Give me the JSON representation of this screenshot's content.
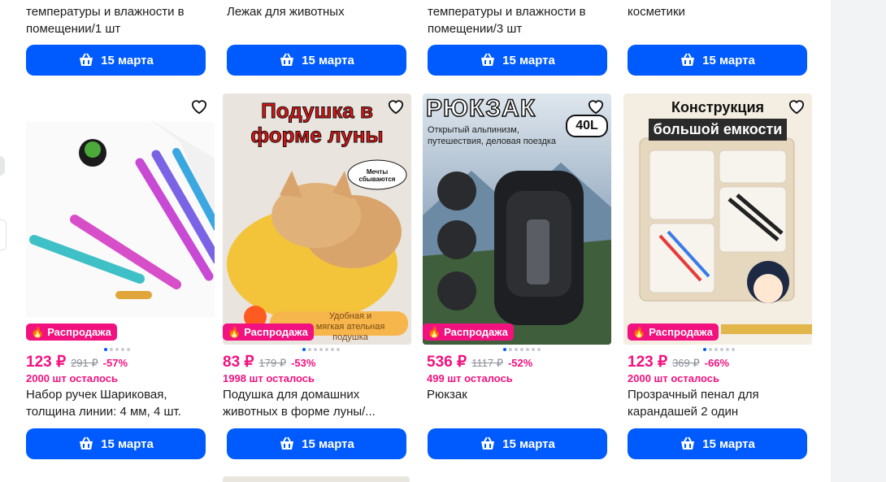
{
  "colors": {
    "accent": "#005bff",
    "sale": "#f2127f"
  },
  "top_row": [
    {
      "title": "температуры и влажности в помещении/1 шт",
      "button": "15 марта"
    },
    {
      "title": "Лежак для животных",
      "button": "15 марта"
    },
    {
      "title": "температуры и влажности в помещении/3 шт",
      "button": "15 марта"
    },
    {
      "title": "косметики",
      "button": "15 марта"
    }
  ],
  "products": [
    {
      "badge": "Распродажа",
      "price": "123 ₽",
      "old_price": "291 ₽",
      "discount": "-57%",
      "stock": "2000 шт осталось",
      "name": "Набор ручек Шариковая, толщина линии: 4 мм, 4 шт.",
      "button": "15 марта",
      "image_text": []
    },
    {
      "badge": "Распродажа",
      "price": "83 ₽",
      "old_price": "179 ₽",
      "discount": "-53%",
      "stock": "1998 шт осталось",
      "name": "Подушка для домашних животных в форме луны/...",
      "button": "15 марта",
      "image_text": [
        "Подушка в",
        "форме луны",
        "Мечты сбываются",
        "Удобная и",
        "мягкая ательная подушка"
      ]
    },
    {
      "badge": "Распродажа",
      "price": "536 ₽",
      "old_price": "1117 ₽",
      "discount": "-52%",
      "stock": "499 шт осталось",
      "name": "Рюкзак",
      "button": "15 марта",
      "image_text": [
        "РЮКЗАК",
        "40L",
        "Открытый альпинизм,",
        "путешествия, деловая поездка"
      ]
    },
    {
      "badge": "Распродажа",
      "price": "123 ₽",
      "old_price": "369 ₽",
      "discount": "-66%",
      "stock": "2000 шт осталось",
      "name": "Прозрачный пенал для карандашей 2 один",
      "button": "15 марта",
      "image_text": [
        "Конструкция",
        "большой емкости"
      ]
    }
  ]
}
